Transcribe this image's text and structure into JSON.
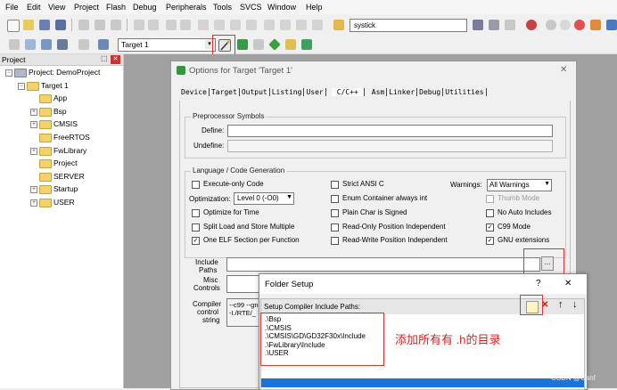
{
  "menu": [
    "File",
    "Edit",
    "View",
    "Project",
    "Flash",
    "Debug",
    "Peripherals",
    "Tools",
    "SVCS",
    "Window",
    "Help"
  ],
  "toolbar": {
    "search_value": "systick",
    "target_select": "Target 1"
  },
  "project_panel": {
    "title": "Project",
    "pin_glyph": "⬚",
    "close_glyph": "✕",
    "tree": [
      {
        "label": "Project: DemoProject",
        "level": 0,
        "expander": "−"
      },
      {
        "label": "Target 1",
        "level": 1,
        "expander": "−"
      },
      {
        "label": "App",
        "level": 2,
        "expander": ""
      },
      {
        "label": "Bsp",
        "level": 2,
        "expander": "+"
      },
      {
        "label": "CMSIS",
        "level": 2,
        "expander": "+"
      },
      {
        "label": "FreeRTOS",
        "level": 2,
        "expander": ""
      },
      {
        "label": "FwLibrary",
        "level": 2,
        "expander": "+"
      },
      {
        "label": "Project",
        "level": 2,
        "expander": ""
      },
      {
        "label": "SERVER",
        "level": 2,
        "expander": ""
      },
      {
        "label": "Startup",
        "level": 2,
        "expander": "+"
      },
      {
        "label": "USER",
        "level": 2,
        "expander": "+"
      }
    ]
  },
  "options_dialog": {
    "title": "Options for Target 'Target 1'",
    "close_glyph": "✕",
    "tabs": [
      "Device",
      "Target",
      "Output",
      "Listing",
      "User",
      "C/C++",
      "Asm",
      "Linker",
      "Debug",
      "Utilities"
    ],
    "active_tab": "C/C++",
    "preprocessor": {
      "title": "Preprocessor Symbols",
      "define_label": "Define:",
      "undefine_label": "Undefine:"
    },
    "codegen": {
      "title": "Language / Code Generation",
      "execute_only": "Execute-only Code",
      "optimization_label": "Optimization:",
      "optimization_value": "Level 0 (-O0)",
      "optimize_time": "Optimize for Time",
      "split_load": "Split Load and Store Multiple",
      "one_elf": "One ELF Section per Function",
      "strict_ansi": "Strict ANSI C",
      "enum_int": "Enum Container always int",
      "plain_char": "Plain Char is Signed",
      "ro_pi": "Read-Only Position Independent",
      "rw_pi": "Read-Write Position Independent",
      "warnings_label": "Warnings:",
      "warnings_value": "All Warnings",
      "thumb_mode": "Thumb Mode",
      "no_auto_inc": "No Auto Includes",
      "c99": "C99 Mode",
      "gnu_ext": "GNU extensions"
    },
    "include_label": [
      "Include",
      "Paths"
    ],
    "misc_label": [
      "Misc",
      "Controls"
    ],
    "compiler_label": [
      "Compiler",
      "control",
      "string"
    ],
    "compiler_text": [
      "--c99 --gnu",
      "-I./RTE/_"
    ],
    "browse_label": "..."
  },
  "folder_setup": {
    "title": "Folder Setup",
    "help_glyph": "?",
    "close_glyph": "✕",
    "list_label": "Setup Compiler Include Paths:",
    "paths": [
      ".\\Bsp",
      ".\\CMSIS",
      ".\\CMSIS\\GD\\GD32F30x\\Include",
      ".\\FwLibrary\\Include",
      ".\\USER"
    ],
    "annotation": "添加所有有 .h的目录",
    "delete_glyph": "✕",
    "up_glyph": "↑",
    "down_glyph": "↓"
  },
  "watermark": "CSDN @Canf",
  "colors": {
    "annotation": "#e02020",
    "selected_row": "#1a73d9",
    "highlight_box": "#e53030"
  }
}
